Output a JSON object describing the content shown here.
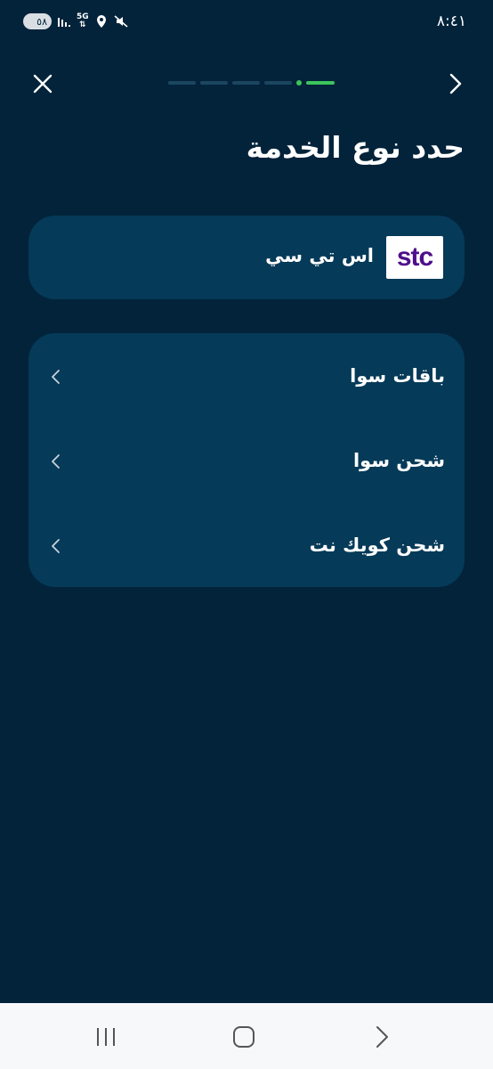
{
  "status_bar": {
    "time": "٨:٤١",
    "battery": "٥٨",
    "network": "5G",
    "icons": [
      "battery-icon",
      "signal-icon",
      "network-5g-icon",
      "location-icon",
      "mute-icon"
    ]
  },
  "header": {
    "close_icon": "close-icon",
    "back_icon": "chevron-right-icon",
    "progress": {
      "total_steps": 5,
      "current_step": 5
    }
  },
  "page": {
    "title": "حدد نوع الخدمة"
  },
  "provider": {
    "logo_text": "stc",
    "name": "اس تي سي"
  },
  "services": [
    {
      "label": "باقات سوا"
    },
    {
      "label": "شحن سوا"
    },
    {
      "label": "شحن كويك نت"
    }
  ],
  "nav_bar": {
    "buttons": [
      "recent-apps-icon",
      "home-icon",
      "back-icon"
    ]
  },
  "colors": {
    "background": "#02233a",
    "card": "#053a58",
    "progress_active": "#3ec45b",
    "progress_inactive": "#1c4660",
    "stc_purple": "#4f0e8c"
  }
}
